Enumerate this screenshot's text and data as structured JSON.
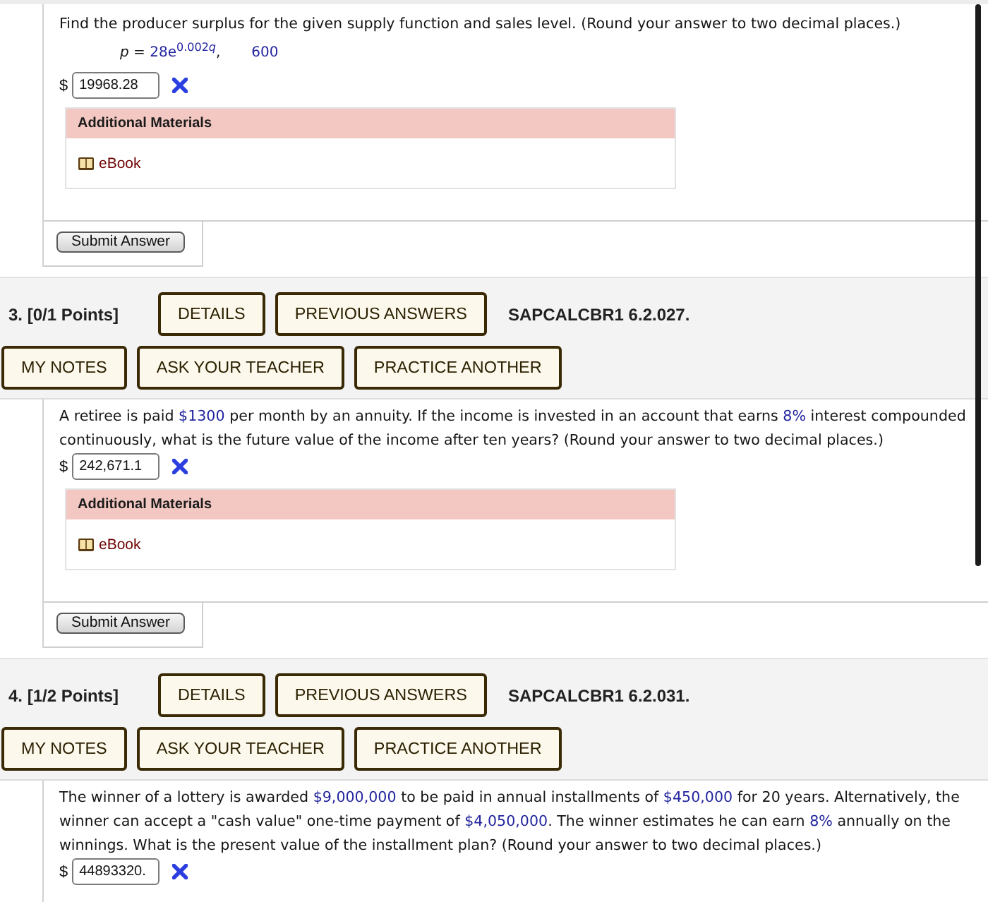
{
  "questions": [
    {
      "prompt": [
        {
          "kind": "text",
          "text": "Find the producer surplus for the given supply function and sales level. (Round your answer to two decimal places.)"
        }
      ],
      "formula": [
        {
          "kind": "var",
          "text": "p"
        },
        {
          "kind": "text",
          "text": " = "
        },
        {
          "kind": "given",
          "text": "28e"
        },
        {
          "kind": "given_sup",
          "text": "0.002"
        },
        {
          "kind": "var_sup",
          "text": "q"
        },
        {
          "kind": "text",
          "text": ","
        }
      ],
      "sales_level": "600",
      "answer": {
        "prefix": "$",
        "value": "19968.28",
        "correct": false
      },
      "materials": {
        "title": "Additional Materials",
        "links": [
          "eBook"
        ]
      },
      "submit": "Submit Answer"
    },
    {
      "header": {
        "title": "3. [0/1 Points]",
        "buttons": [
          "DETAILS",
          "PREVIOUS ANSWERS"
        ],
        "code": "SAPCALCBR1 6.2.027.",
        "tools": [
          "MY NOTES",
          "ASK YOUR TEACHER",
          "PRACTICE ANOTHER"
        ]
      },
      "prompt": [
        {
          "kind": "text",
          "text": "A retiree is paid "
        },
        {
          "kind": "given",
          "text": "$1300"
        },
        {
          "kind": "text",
          "text": " per month by an annuity. If the income is invested in an account that earns "
        },
        {
          "kind": "given",
          "text": "8%"
        },
        {
          "kind": "text",
          "text": " interest compounded continuously, what is the future value of the income after ten years? (Round your answer to two decimal places.)"
        }
      ],
      "answer": {
        "prefix": "$",
        "value": "242,671.1",
        "correct": false
      },
      "materials": {
        "title": "Additional Materials",
        "links": [
          "eBook"
        ]
      },
      "submit": "Submit Answer"
    },
    {
      "header": {
        "title": "4. [1/2 Points]",
        "buttons": [
          "DETAILS",
          "PREVIOUS ANSWERS"
        ],
        "code": "SAPCALCBR1 6.2.031.",
        "tools": [
          "MY NOTES",
          "ASK YOUR TEACHER",
          "PRACTICE ANOTHER"
        ]
      },
      "prompt": [
        {
          "kind": "text",
          "text": "The winner of a lottery is awarded "
        },
        {
          "kind": "given",
          "text": "$9,000,000"
        },
        {
          "kind": "text",
          "text": " to be paid in annual installments of "
        },
        {
          "kind": "given",
          "text": "$450,000"
        },
        {
          "kind": "text",
          "text": " for 20 years. Alternatively, the winner can accept a \"cash value\" one-time payment of "
        },
        {
          "kind": "given",
          "text": "$4,050,000"
        },
        {
          "kind": "text",
          "text": ". The winner estimates he can earn "
        },
        {
          "kind": "given",
          "text": "8%"
        },
        {
          "kind": "text",
          "text": " annually on the winnings. What is the present value of the installment plan? (Round your answer to two decimal places.)"
        }
      ],
      "answer": {
        "prefix": "$",
        "value": "44893320.",
        "correct": false
      }
    }
  ]
}
